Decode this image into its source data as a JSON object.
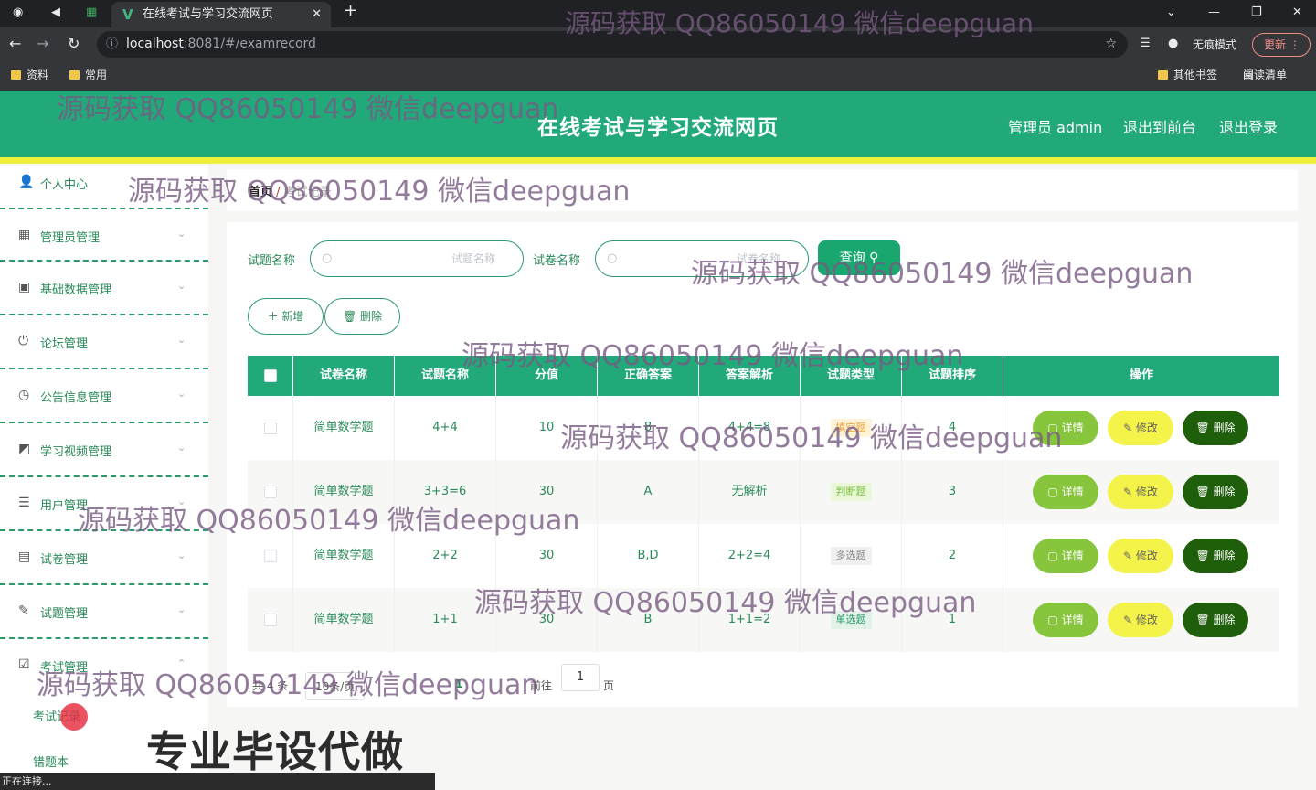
{
  "browser": {
    "tab_title": "在线考试与学习交流网页",
    "url_host": "localhost",
    "url_path": ":8081/#/examrecord",
    "incognito_label": "无痕模式",
    "update_label": "更新",
    "bookmarks": [
      "资料",
      "常用"
    ],
    "other_bookmarks": "其他书签",
    "reading_list": "阅读清单"
  },
  "header": {
    "title": "在线考试与学习交流网页",
    "user": "管理员 admin",
    "front": "退出到前台",
    "logout": "退出登录"
  },
  "sidebar": {
    "items": [
      {
        "label": "个人中心",
        "icon": "user-icon"
      },
      {
        "label": "管理员管理",
        "icon": "grid-icon"
      },
      {
        "label": "基础数据管理",
        "icon": "clipboard-icon"
      },
      {
        "label": "论坛管理",
        "icon": "power-icon"
      },
      {
        "label": "公告信息管理",
        "icon": "clock-icon"
      },
      {
        "label": "学习视频管理",
        "icon": "chart-icon"
      },
      {
        "label": "用户管理",
        "icon": "list-icon"
      },
      {
        "label": "试卷管理",
        "icon": "chat-icon"
      },
      {
        "label": "试题管理",
        "icon": "edit-icon"
      },
      {
        "label": "考试管理",
        "icon": "check-icon"
      }
    ],
    "subitems": [
      "考试记录",
      "错题本"
    ]
  },
  "breadcrumb": {
    "home": "首页",
    "sep": "/",
    "current": "考试记录"
  },
  "filters": {
    "q1_label": "试题名称",
    "q1_placeholder": "试题名称",
    "q2_label": "试卷名称",
    "q2_placeholder": "试卷名称",
    "query_btn": "查询"
  },
  "actions": {
    "add": "新增",
    "delete": "删除"
  },
  "table": {
    "columns": [
      "试卷名称",
      "试题名称",
      "分值",
      "正确答案",
      "答案解析",
      "试题类型",
      "试题排序",
      "操作"
    ],
    "rows": [
      {
        "paper": "简单数学题",
        "question": "4+4",
        "score": "10",
        "answer": "8",
        "analysis": "4+4=8",
        "type": "填空题",
        "order": "4"
      },
      {
        "paper": "简单数学题",
        "question": "3+3=6",
        "score": "30",
        "answer": "A",
        "analysis": "无解析",
        "type": "判断题",
        "order": "3"
      },
      {
        "paper": "简单数学题",
        "question": "2+2",
        "score": "30",
        "answer": "B,D",
        "analysis": "2+2=4",
        "type": "多选题",
        "order": "2"
      },
      {
        "paper": "简单数学题",
        "question": "1+1",
        "score": "30",
        "answer": "B",
        "analysis": "1+1=2",
        "type": "单选题",
        "order": "1"
      }
    ],
    "row_actions": {
      "detail": "详情",
      "edit": "修改",
      "delete": "删除"
    }
  },
  "pager": {
    "total": "共 4 条",
    "size": "10条/页",
    "page": "1",
    "goto": "前往",
    "goto_page": "1",
    "unit": "页"
  },
  "watermark": "源码获取 QQ86050149 微信deepguan",
  "promo": "专业毕设代做",
  "status": "正在连接..."
}
